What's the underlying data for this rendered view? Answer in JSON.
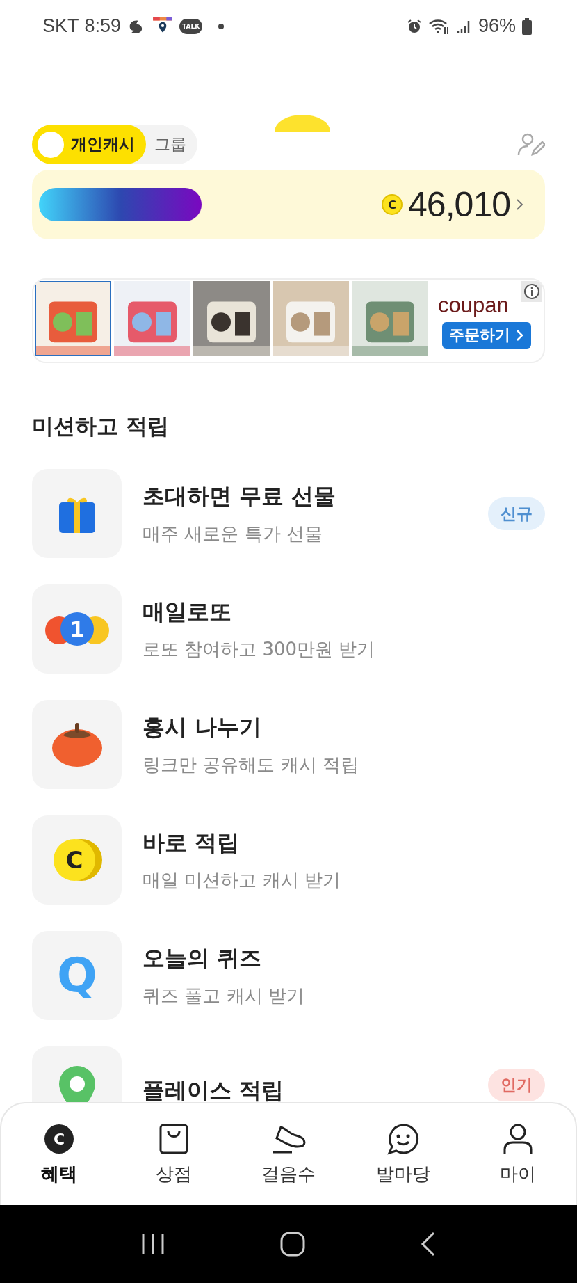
{
  "status_bar": {
    "carrier": "SKT",
    "time": "8:59",
    "talk_badge": "TALK",
    "battery": "96%"
  },
  "account_tabs": [
    {
      "label": "개인캐시",
      "selected": true
    },
    {
      "label": "그룹",
      "selected": false
    }
  ],
  "balance": {
    "amount": "46,010",
    "coin": "C"
  },
  "ad": {
    "brand": "coupan",
    "button": "주문하기"
  },
  "section_title": "미션하고 적립",
  "missions": [
    {
      "kind": "gift",
      "title": "초대하면 무료 선물",
      "subtitle": "매주 새로운 특가 선물",
      "badge": {
        "text": "신규",
        "kind": "new"
      }
    },
    {
      "kind": "lotto",
      "title": "매일로또",
      "subtitle": "로또 참여하고 300만원 받기",
      "badge_digit": "1"
    },
    {
      "kind": "persimmon",
      "title": "홍시 나누기",
      "subtitle": "링크만 공유해도 캐시 적립"
    },
    {
      "kind": "coin",
      "title": "바로 적립",
      "subtitle": "매일 미션하고 캐시 받기",
      "coin_letter": "C"
    },
    {
      "kind": "quiz",
      "title": "오늘의 퀴즈",
      "subtitle": "퀴즈 풀고 캐시 받기",
      "quiz_letter": "Q"
    },
    {
      "kind": "pin",
      "title": "플레이스 적립",
      "badge": {
        "text": "인기",
        "kind": "hot"
      }
    }
  ],
  "nav": [
    {
      "kind": "coin",
      "label": "혜택",
      "selected": true,
      "glyph": "C"
    },
    {
      "kind": "bag",
      "label": "상점",
      "selected": false
    },
    {
      "kind": "shoe",
      "label": "걸음수",
      "selected": false
    },
    {
      "kind": "chat",
      "label": "발마당",
      "selected": false
    },
    {
      "kind": "person",
      "label": "마이",
      "selected": false
    }
  ]
}
